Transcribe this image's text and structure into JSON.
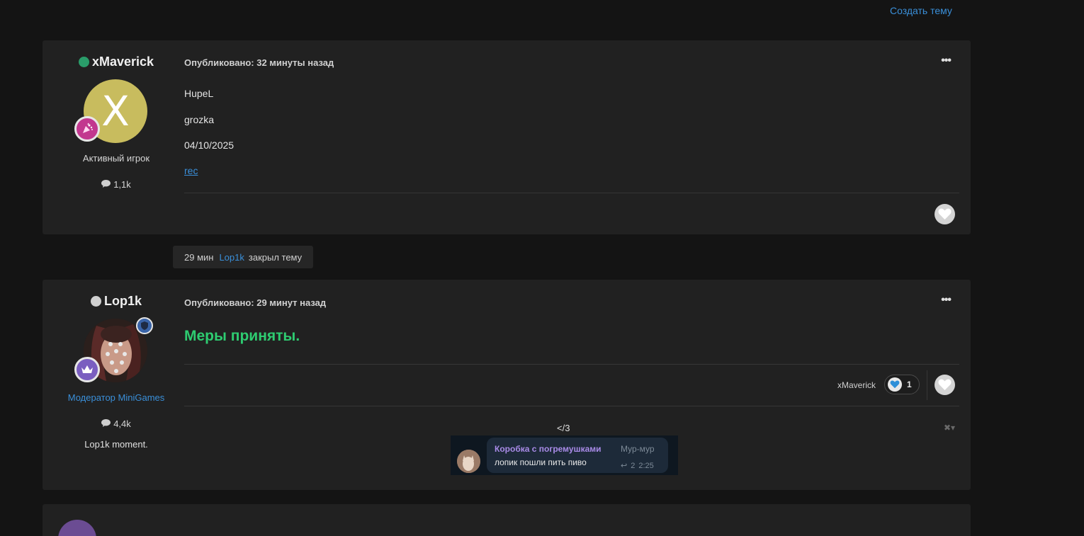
{
  "header": {
    "create_topic": "Создать тему"
  },
  "post1": {
    "author": "xMaverick",
    "online": true,
    "avatar_letter": "X",
    "avatar_color": "#c8bc5e",
    "role": "Активный игрок",
    "post_count": "1,1k",
    "published": "Опубликовано: 32 минуты назад",
    "lines": [
      "HupeL",
      "grozka",
      "04/10/2025"
    ],
    "link": "rec"
  },
  "event": {
    "time": "29 мин",
    "user": "Lop1k",
    "action": "закрыл тему"
  },
  "post2": {
    "author": "Lop1k",
    "online": false,
    "role": "Модератор MiniGames",
    "post_count": "4,4k",
    "signature": "Lop1k moment.",
    "published": "Опубликовано: 29 минут назад",
    "message": "Меры приняты.",
    "reaction_user": "xMaverick",
    "reaction_count": "1",
    "embed_label": "</3",
    "telegram": {
      "sender": "Коробка с погремушками",
      "tag": "Мур-мур",
      "text": "лопик пошли пить пиво",
      "replies": "2",
      "time": "2:25"
    }
  },
  "colors": {
    "accent": "#3a8fd9",
    "online": "#2a9d6a",
    "offline": "#d0d0d0",
    "message_green": "#2ecc71",
    "badge_pink": "#c2378f",
    "badge_purple": "#7a5ec0",
    "badge_blue": "#3a64a8"
  }
}
